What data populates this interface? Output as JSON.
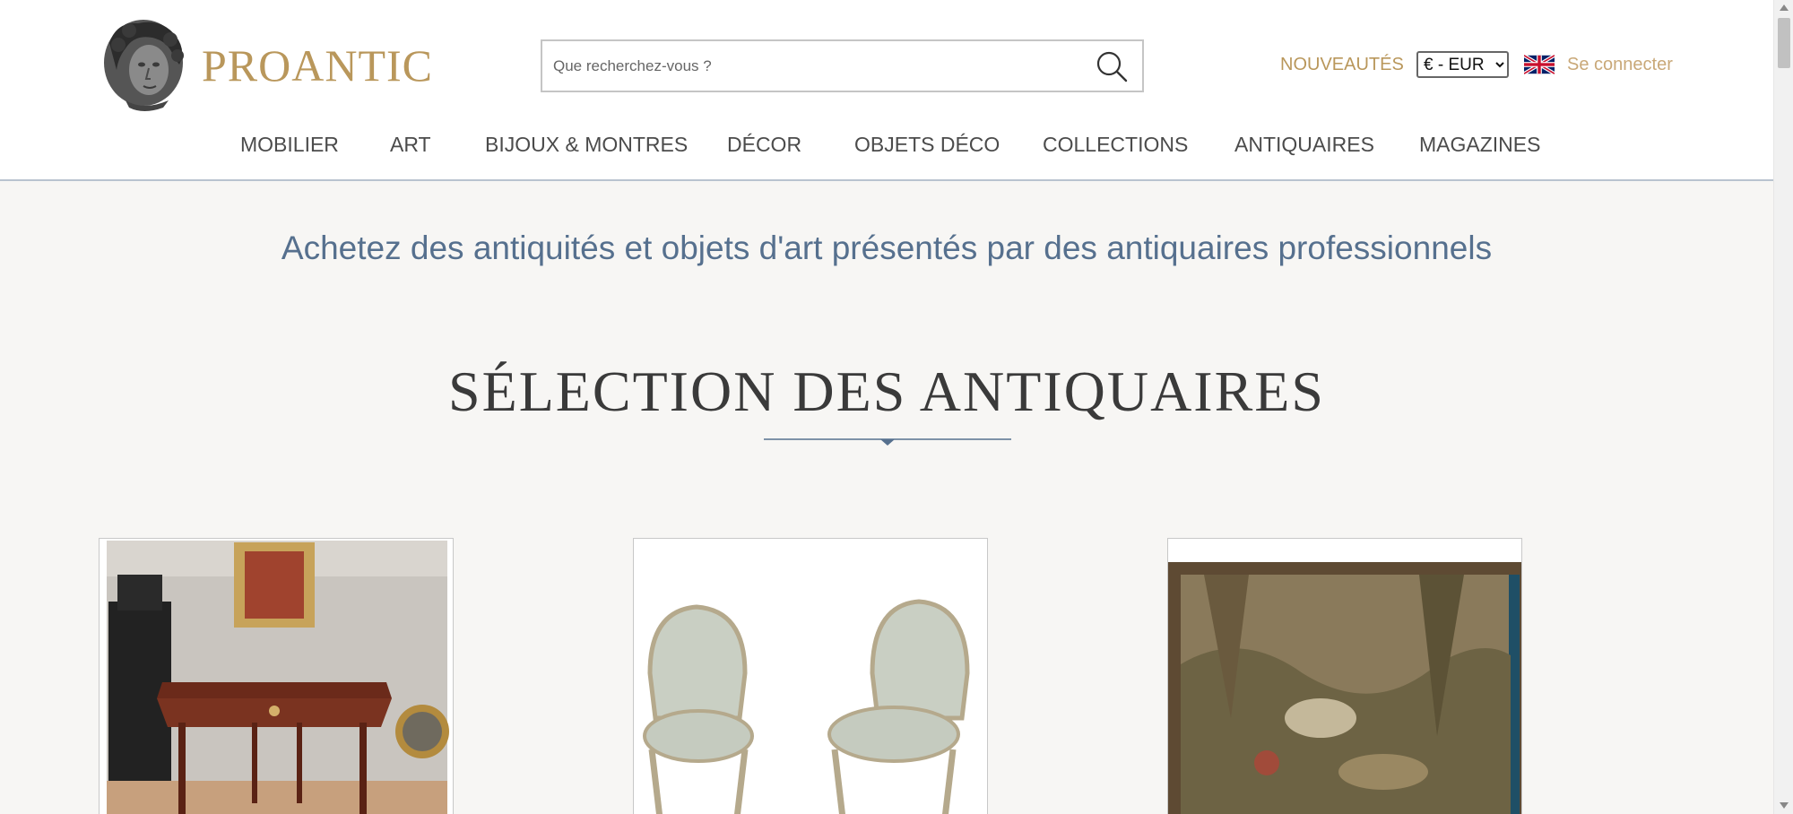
{
  "header": {
    "brand": "PROANTIC",
    "search_placeholder": "Que recherchez-vous ?",
    "new_label": "NOUVEAUTÉS",
    "currency": {
      "selected": "€ - EUR",
      "options": [
        "€ - EUR"
      ]
    },
    "login_label": "Se connecter"
  },
  "nav": {
    "items": [
      {
        "label": "MOBILIER"
      },
      {
        "label": "ART"
      },
      {
        "label": "BIJOUX & MONTRES"
      },
      {
        "label": "DÉCOR"
      },
      {
        "label": "OBJETS DÉCO"
      },
      {
        "label": "COLLECTIONS"
      },
      {
        "label": "ANTIQUAIRES"
      },
      {
        "label": "MAGAZINES"
      }
    ]
  },
  "main": {
    "tagline": "Achetez des antiquités et objets d'art présentés par des antiquaires professionnels",
    "section_title": "SÉLECTION DES ANTIQUAIRES"
  },
  "colors": {
    "brand_gold": "#b9975b",
    "accent_blue": "#56708e",
    "page_bg": "#f7f6f4"
  }
}
